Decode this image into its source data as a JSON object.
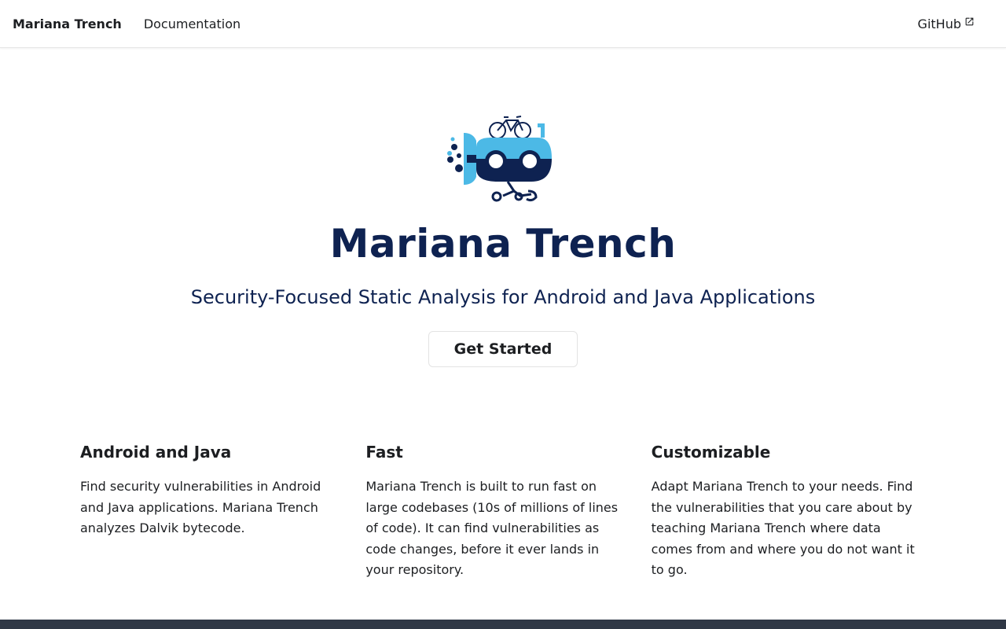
{
  "navbar": {
    "brand": "Mariana Trench",
    "links": [
      "Documentation"
    ],
    "github": "GitHub"
  },
  "hero": {
    "title": "Mariana Trench",
    "subtitle": "Security-Focused Static Analysis for Android and Java Applications",
    "cta_label": "Get Started"
  },
  "features": [
    {
      "title": "Android and Java",
      "text": "Find security vulnerabilities in Android and Java applications. Mariana Trench analyzes Dalvik bytecode."
    },
    {
      "title": "Fast",
      "text": "Mariana Trench is built to run fast on large codebases (10s of millions of lines of code). It can find vulnerabilities as code changes, before it ever lands in your repository."
    },
    {
      "title": "Customizable",
      "text": "Adapt Mariana Trench to your needs. Find the vulnerabilities that you care about by teaching Mariana Trench where data comes from and where you do not want it to go."
    }
  ],
  "colors": {
    "title": "#0e2251",
    "logo_light": "#4cb9e6",
    "logo_dark": "#0e2251",
    "footer": "#303846"
  },
  "icons": {
    "logo": "submarine-robot-logo",
    "external_link": "external-link-icon"
  }
}
